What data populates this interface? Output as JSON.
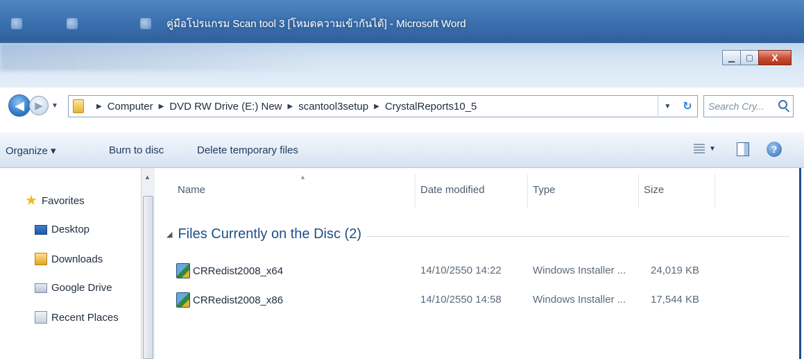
{
  "window": {
    "title": "คู่มือโปรแกรม Scan tool 3 [โหมดความเข้ากันได้] - Microsoft Word",
    "buttons": {
      "minimize": "▁",
      "maximize": "▢",
      "close": "X"
    }
  },
  "address_bar": {
    "crumbs": [
      "Computer",
      "DVD RW Drive (E:) New",
      "scantool3setup",
      "CrystalReports10_5"
    ]
  },
  "search": {
    "placeholder": "Search Cry..."
  },
  "toolbar": {
    "organize": "Organize ▾",
    "burn": "Burn to disc",
    "delete_temp": "Delete temporary files"
  },
  "nav_pane": {
    "favorites": "Favorites",
    "items": [
      {
        "label": "Desktop",
        "icon": "desktop-icon"
      },
      {
        "label": "Downloads",
        "icon": "downloads-icon"
      },
      {
        "label": "Google Drive",
        "icon": "drive-icon"
      },
      {
        "label": "Recent Places",
        "icon": "recent-icon"
      }
    ]
  },
  "file_list": {
    "columns": [
      "Name",
      "Date modified",
      "Type",
      "Size"
    ],
    "group": "Files Currently on the Disc (2)",
    "rows": [
      {
        "name": "CRRedist2008_x64",
        "date": "14/10/2550 14:22",
        "type": "Windows Installer ...",
        "size": "24,019 KB"
      },
      {
        "name": "CRRedist2008_x86",
        "date": "14/10/2550 14:58",
        "type": "Windows Installer ...",
        "size": "17,544 KB"
      }
    ]
  },
  "colors": {
    "accent": "#1e4e86",
    "titlebar": "#3a6fae"
  }
}
